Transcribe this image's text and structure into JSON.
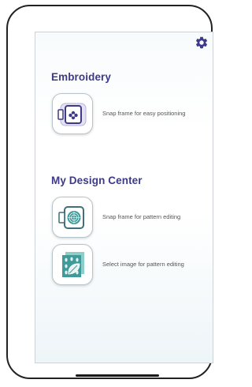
{
  "icons": {
    "settings": "gear-icon",
    "embroidery_snap": "embroidery-frame-snap-icon",
    "design_snap": "design-frame-snap-icon",
    "design_image": "design-image-select-icon"
  },
  "colors": {
    "section_title": "#3d3a86",
    "tile_border": "#b9c5cc",
    "teal": "#3f9a99"
  },
  "embroidery": {
    "title": "Embroidery",
    "items": [
      {
        "label": "Snap frame for easy positioning"
      }
    ]
  },
  "design_center": {
    "title": "My Design Center",
    "items": [
      {
        "label": "Snap frame for pattern editing"
      },
      {
        "label": "Select image for pattern editing"
      }
    ]
  }
}
